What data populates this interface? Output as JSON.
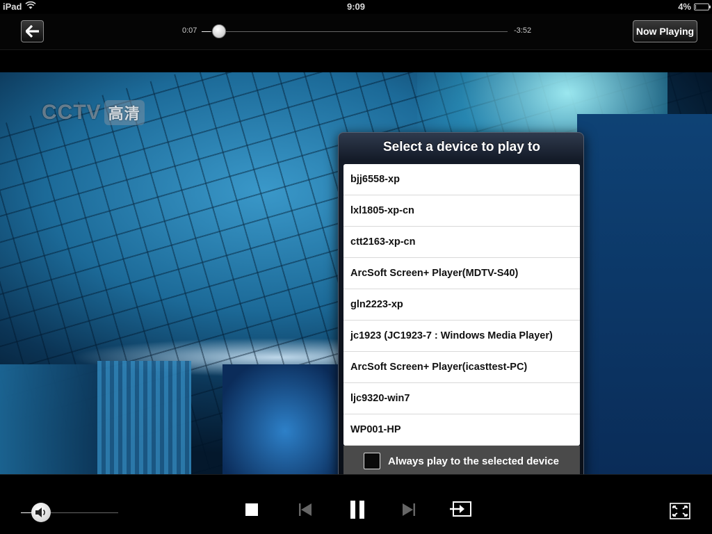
{
  "status_bar": {
    "carrier": "iPad",
    "time": "9:09",
    "battery": "4%",
    "battery_level": 0.04
  },
  "top_nav": {
    "back_icon": "back-arrow-icon",
    "elapsed": "0:07",
    "remaining": "-3:52",
    "progress": 0.03,
    "now_playing_label": "Now Playing"
  },
  "video": {
    "logo_text": "CCTV",
    "logo_hd": "高清"
  },
  "device_picker": {
    "title": "Select a device to play to",
    "devices": [
      "bjj6558-xp",
      "lxl1805-xp-cn",
      "ctt2163-xp-cn",
      "ArcSoft Screen+ Player(MDTV-S40)",
      "gln2223-xp",
      "jc1923 (JC1923-7 : Windows Media Player)",
      "ArcSoft Screen+ Player(icasttest-PC)",
      "ljc9320-win7",
      "WP001-HP"
    ],
    "always_play_label": "Always play to the selected device",
    "always_play_checked": false
  },
  "controls": {
    "volume_level": 0.2,
    "icons": [
      "speaker-icon",
      "stop-icon",
      "previous-icon",
      "pause-icon",
      "next-icon",
      "play-to-device-icon",
      "fullscreen-icon"
    ]
  },
  "colors": {
    "background": "#000000",
    "popover": "#0a0f18",
    "list_bg": "#ffffff",
    "text_dark": "#111111"
  }
}
